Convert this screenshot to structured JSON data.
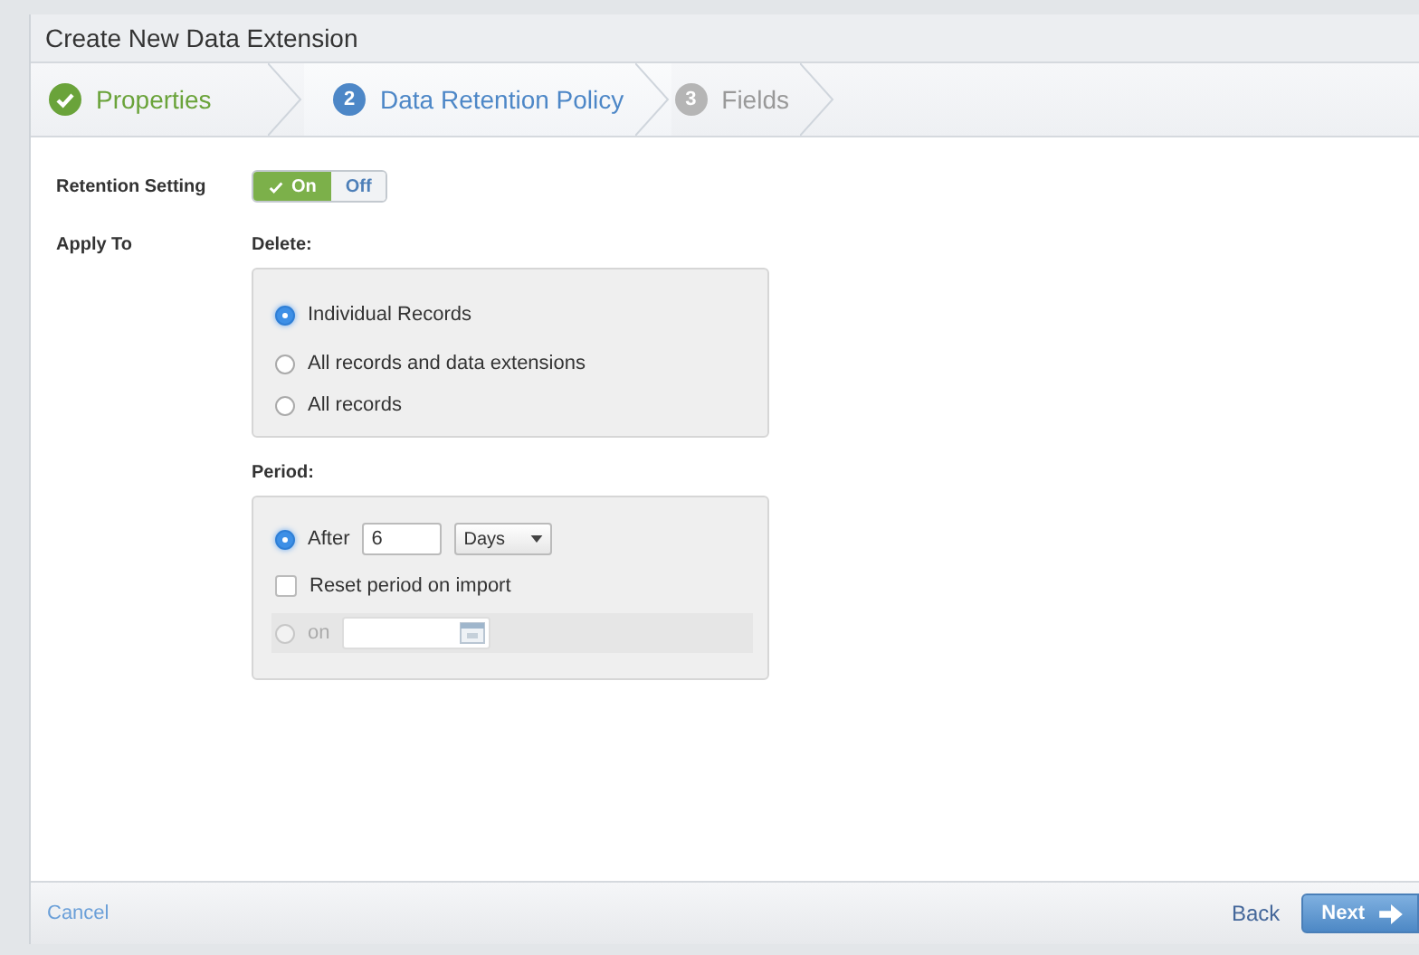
{
  "window": {
    "title": "Create New Data Extension"
  },
  "steps": [
    {
      "label": "Properties",
      "completed": true,
      "selected": false
    },
    {
      "number": "2",
      "label": "Data Retention Policy",
      "completed": false,
      "selected": true
    },
    {
      "number": "3",
      "label": "Fields",
      "completed": false,
      "selected": false
    }
  ],
  "retention_setting": {
    "label": "Retention Setting",
    "on": true,
    "on_label": "On",
    "off_label": "Off"
  },
  "apply_to": {
    "label": "Apply To",
    "delete_heading": "Delete:",
    "delete_options": [
      {
        "label": "Individual Records",
        "selected": true
      },
      {
        "label": "All records and data extensions",
        "selected": false
      },
      {
        "label": "All records",
        "selected": false
      }
    ],
    "period_heading": "Period:",
    "period_options": [
      {
        "kind": "after",
        "label": "After",
        "selected": true,
        "value": "6",
        "unit": "Days"
      },
      {
        "kind": "check",
        "label": "Reset period on import",
        "checked": false
      },
      {
        "kind": "date",
        "label": "on",
        "selected": false,
        "disabled": true
      }
    ]
  },
  "footer": {
    "cancel": "Cancel",
    "back": "Back",
    "next": "Next"
  }
}
